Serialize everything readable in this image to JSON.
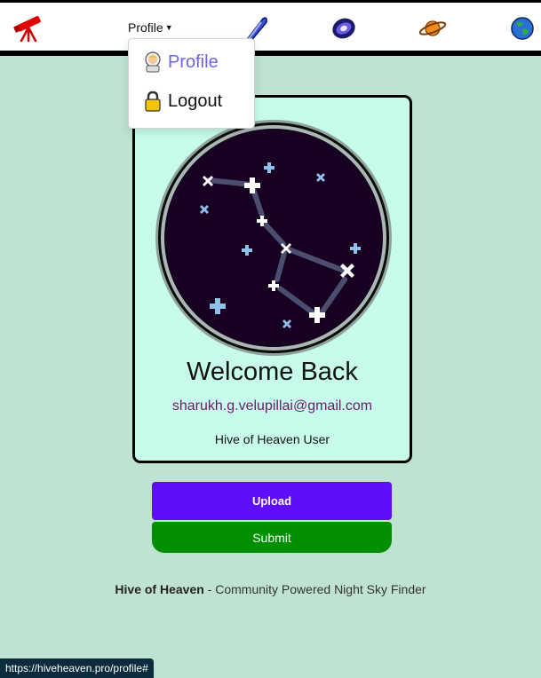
{
  "nav": {
    "profile_label": "Profile",
    "icons": [
      "telescope-icon",
      "comet-icon",
      "galaxy-icon",
      "planet-icon",
      "earth-icon"
    ]
  },
  "dropdown": {
    "items": [
      {
        "label": "Profile",
        "icon": "astronaut-icon"
      },
      {
        "label": "Logout",
        "icon": "lock-icon"
      }
    ]
  },
  "card": {
    "title": "Welcome Back",
    "email": "sharukh.g.velupillai@gmail.com",
    "role": "Hive of Heaven User"
  },
  "actions": {
    "upload_label": "Upload",
    "submit_label": "Submit"
  },
  "footer": {
    "brand": "Hive of Heaven",
    "tagline": " - Community Powered Night Sky Finder"
  },
  "status_bar": {
    "url": "https://hiveheaven.pro/profile#"
  },
  "colors": {
    "page_bg": "#bfe2d2",
    "card_bg": "#c7fcec",
    "upload": "#5f0efc",
    "submit": "#008f00",
    "dropdown_active": "#6c63e8"
  }
}
